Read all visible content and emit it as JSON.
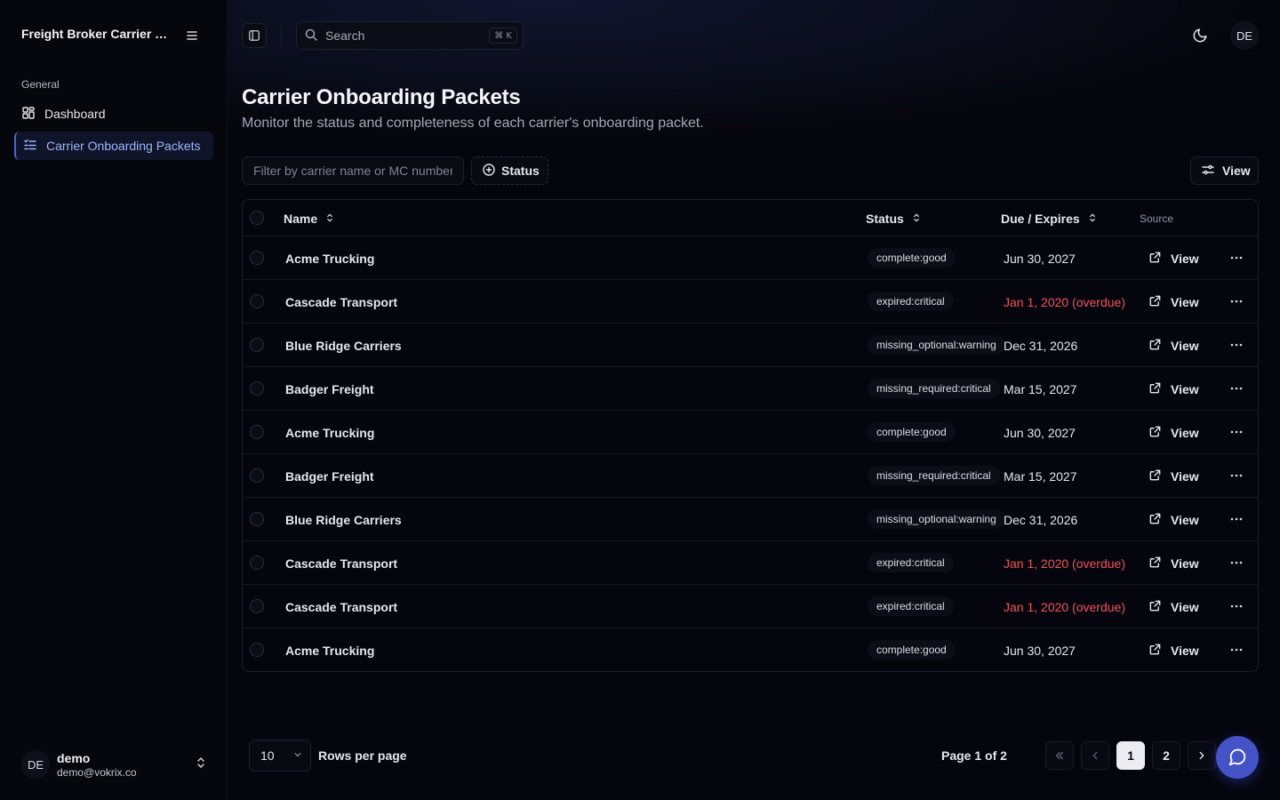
{
  "app": {
    "brand_title": "Freight Broker Carrier Onboarding",
    "nav_section": "General",
    "nav_items": [
      {
        "label": "Dashboard",
        "icon": "grid-icon"
      },
      {
        "label": "Carrier Onboarding Packets",
        "icon": "list-icon"
      }
    ],
    "user": {
      "initials": "DE",
      "name": "demo",
      "email": "demo@vokrix.co"
    }
  },
  "topbar": {
    "search_label": "Search",
    "search_shortcut": "⌘ K",
    "avatar_initials": "DE"
  },
  "header": {
    "title": "Carrier Onboarding Packets",
    "subtitle": "Monitor the status and completeness of each carrier's onboarding packet."
  },
  "toolbar": {
    "filter_placeholder": "Filter by carrier name or MC number...",
    "status_label": "Status",
    "view_label": "View"
  },
  "table": {
    "columns": {
      "name": "Name",
      "status": "Status",
      "due": "Due / Expires",
      "source": "Source"
    },
    "rows": [
      {
        "name": "Acme Trucking",
        "status": "complete:good",
        "due": "Jun 30, 2027",
        "overdue": false,
        "action": "View"
      },
      {
        "name": "Cascade Transport",
        "status": "expired:critical",
        "due": "Jan 1, 2020 (overdue)",
        "overdue": true,
        "action": "View"
      },
      {
        "name": "Blue Ridge Carriers",
        "status": "missing_optional:warning",
        "due": "Dec 31, 2026",
        "overdue": false,
        "action": "View"
      },
      {
        "name": "Badger Freight",
        "status": "missing_required:critical",
        "due": "Mar 15, 2027",
        "overdue": false,
        "action": "View"
      },
      {
        "name": "Acme Trucking",
        "status": "complete:good",
        "due": "Jun 30, 2027",
        "overdue": false,
        "action": "View"
      },
      {
        "name": "Badger Freight",
        "status": "missing_required:critical",
        "due": "Mar 15, 2027",
        "overdue": false,
        "action": "View"
      },
      {
        "name": "Blue Ridge Carriers",
        "status": "missing_optional:warning",
        "due": "Dec 31, 2026",
        "overdue": false,
        "action": "View"
      },
      {
        "name": "Cascade Transport",
        "status": "expired:critical",
        "due": "Jan 1, 2020 (overdue)",
        "overdue": true,
        "action": "View"
      },
      {
        "name": "Cascade Transport",
        "status": "expired:critical",
        "due": "Jan 1, 2020 (overdue)",
        "overdue": true,
        "action": "View"
      },
      {
        "name": "Acme Trucking",
        "status": "complete:good",
        "due": "Jun 30, 2027",
        "overdue": false,
        "action": "View"
      }
    ]
  },
  "pagination": {
    "rows_per_page_value": "10",
    "rows_per_page_label": "Rows per page",
    "page_info": "Page 1 of 2",
    "pages": [
      "1",
      "2"
    ],
    "current_page": "1"
  },
  "colors": {
    "accent": "#4453c8",
    "overdue": "#f2515c",
    "active_nav": "#9db5ff"
  }
}
